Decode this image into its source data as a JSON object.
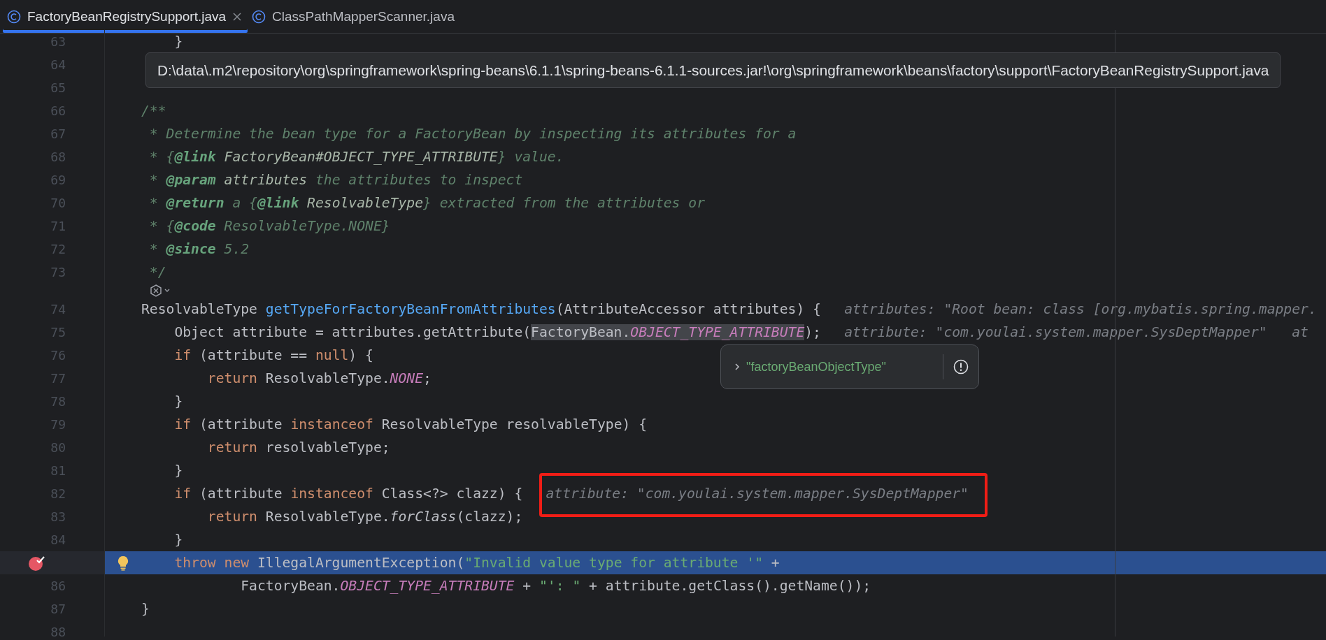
{
  "tabs": [
    {
      "label": "FactoryBeanRegistrySupport.java",
      "selected": true,
      "closable": true
    },
    {
      "label": "ClassPathMapperScanner.java",
      "selected": false,
      "closable": false
    }
  ],
  "path_tooltip": "D:\\data\\.m2\\repository\\org\\springframework\\spring-beans\\6.1.1\\spring-beans-6.1.1-sources.jar!\\org\\springframework\\beans\\factory\\support\\FactoryBeanRegistrySupport.java",
  "lines": [
    {
      "kind": "code",
      "n": "63",
      "current": false,
      "code": [
        {
          "kind": "plain",
          "text": "    }"
        }
      ]
    },
    {
      "kind": "code",
      "n": "64",
      "current": false
    },
    {
      "kind": "code",
      "n": "65",
      "current": false
    },
    {
      "kind": "code",
      "n": "66",
      "current": false,
      "code": [
        {
          "kind": "comment",
          "text": "/**"
        }
      ]
    },
    {
      "kind": "code",
      "n": "67",
      "current": false,
      "code": [
        {
          "kind": "comment",
          "text": " * Determine the bean type for a FactoryBean by inspecting its attributes for a"
        }
      ]
    },
    {
      "kind": "code",
      "n": "68",
      "current": false,
      "code": [
        {
          "kind": "comment",
          "text": " * {"
        },
        {
          "kind": "doctag",
          "text": "@link"
        },
        {
          "kind": "docref",
          "text": " FactoryBean#OBJECT_TYPE_ATTRIBUTE"
        },
        {
          "kind": "comment",
          "text": "} value."
        }
      ]
    },
    {
      "kind": "code",
      "n": "69",
      "current": false,
      "code": [
        {
          "kind": "comment",
          "text": " * "
        },
        {
          "kind": "doctag",
          "text": "@param"
        },
        {
          "kind": "docref",
          "text": " attributes"
        },
        {
          "kind": "comment",
          "text": " the attributes to inspect"
        }
      ]
    },
    {
      "kind": "code",
      "n": "70",
      "current": false,
      "code": [
        {
          "kind": "comment",
          "text": " * "
        },
        {
          "kind": "doctag",
          "text": "@return"
        },
        {
          "kind": "comment",
          "text": " a {"
        },
        {
          "kind": "doctag",
          "text": "@link"
        },
        {
          "kind": "docref",
          "text": " ResolvableType"
        },
        {
          "kind": "comment",
          "text": "} extracted from the attributes or"
        }
      ]
    },
    {
      "kind": "code",
      "n": "71",
      "current": false,
      "code": [
        {
          "kind": "comment",
          "text": " * {"
        },
        {
          "kind": "doctag",
          "text": "@code"
        },
        {
          "kind": "comment",
          "text": " ResolvableType.NONE}"
        }
      ]
    },
    {
      "kind": "code",
      "n": "72",
      "current": false,
      "code": [
        {
          "kind": "comment",
          "text": " * "
        },
        {
          "kind": "doctag",
          "text": "@since"
        },
        {
          "kind": "comment",
          "text": " 5.2"
        }
      ]
    },
    {
      "kind": "code",
      "n": "73",
      "current": false,
      "code": [
        {
          "kind": "comment",
          "text": " */"
        }
      ]
    },
    {
      "kind": "inlay",
      "current": false
    },
    {
      "kind": "code",
      "n": "74",
      "current": false,
      "code": [
        {
          "kind": "plain",
          "text": "ResolvableType "
        },
        {
          "kind": "decl",
          "text": "getTypeForFactoryBeanFromAttributes"
        },
        {
          "kind": "plain",
          "text": "(AttributeAccessor attributes) {"
        }
      ],
      "hints": [
        "attributes: \"Root bean: class [org.mybatis.spring.mapper."
      ]
    },
    {
      "kind": "code",
      "n": "75",
      "current": false,
      "code": [
        {
          "kind": "plain",
          "text": "    Object attribute = attributes.getAttribute("
        },
        {
          "kind": "marked",
          "text": "FactoryBean."
        },
        {
          "kind": "marked-static",
          "text": "OBJECT_TYPE_ATTRIBUTE"
        },
        {
          "kind": "plain",
          "text": ");"
        }
      ],
      "hints": [
        "attribute: \"com.youlai.system.mapper.SysDeptMapper\"",
        "at"
      ]
    },
    {
      "kind": "code",
      "n": "76",
      "current": false,
      "code": [
        {
          "kind": "keyword",
          "text": "    if"
        },
        {
          "kind": "plain",
          "text": " (attribute == "
        },
        {
          "kind": "keyword",
          "text": "null"
        },
        {
          "kind": "plain",
          "text": ") {"
        }
      ]
    },
    {
      "kind": "code",
      "n": "77",
      "current": false,
      "code": [
        {
          "kind": "keyword",
          "text": "        return"
        },
        {
          "kind": "plain",
          "text": " ResolvableType."
        },
        {
          "kind": "static",
          "text": "NONE"
        },
        {
          "kind": "plain",
          "text": ";"
        }
      ]
    },
    {
      "kind": "code",
      "n": "78",
      "current": false,
      "code": [
        {
          "kind": "plain",
          "text": "    }"
        }
      ]
    },
    {
      "kind": "code",
      "n": "79",
      "current": false,
      "code": [
        {
          "kind": "keyword",
          "text": "    if"
        },
        {
          "kind": "plain",
          "text": " (attribute "
        },
        {
          "kind": "keyword",
          "text": "instanceof"
        },
        {
          "kind": "plain",
          "text": " ResolvableType resolvableType) {"
        }
      ]
    },
    {
      "kind": "code",
      "n": "80",
      "current": false,
      "code": [
        {
          "kind": "keyword",
          "text": "        return"
        },
        {
          "kind": "plain",
          "text": " resolvableType;"
        }
      ]
    },
    {
      "kind": "code",
      "n": "81",
      "current": false,
      "code": [
        {
          "kind": "plain",
          "text": "    }"
        }
      ]
    },
    {
      "kind": "code",
      "n": "82",
      "current": false,
      "code": [
        {
          "kind": "keyword",
          "text": "    if"
        },
        {
          "kind": "plain",
          "text": " (attribute "
        },
        {
          "kind": "keyword",
          "text": "instanceof"
        },
        {
          "kind": "plain",
          "text": " Class<?> clazz) {"
        }
      ],
      "hints": [
        "attribute: \"com.youlai.system.mapper.SysDeptMapper\""
      ]
    },
    {
      "kind": "code",
      "n": "83",
      "current": false,
      "code": [
        {
          "kind": "keyword",
          "text": "        return"
        },
        {
          "kind": "plain",
          "text": " ResolvableType."
        },
        {
          "kind": "italic",
          "text": "forClass"
        },
        {
          "kind": "plain",
          "text": "(clazz);"
        }
      ]
    },
    {
      "kind": "code",
      "n": "84",
      "current": false,
      "code": [
        {
          "kind": "plain",
          "text": "    }"
        }
      ]
    },
    {
      "kind": "breakpoint",
      "current": true,
      "code": [
        {
          "kind": "keyword",
          "text": "    throw new"
        },
        {
          "kind": "plain",
          "text": " IllegalArgumentException("
        },
        {
          "kind": "string",
          "text": "\"Invalid value type for attribute '\""
        },
        {
          "kind": "plain",
          "text": " +"
        }
      ]
    },
    {
      "kind": "code",
      "n": "86",
      "current": false,
      "code": [
        {
          "kind": "plain",
          "text": "            FactoryBean."
        },
        {
          "kind": "static",
          "text": "OBJECT_TYPE_ATTRIBUTE"
        },
        {
          "kind": "plain",
          "text": " + "
        },
        {
          "kind": "string",
          "text": "\"': \""
        },
        {
          "kind": "plain",
          "text": " + attribute.getClass().getName());"
        }
      ]
    },
    {
      "kind": "code",
      "n": "87",
      "current": false,
      "code": [
        {
          "kind": "plain",
          "text": "}"
        }
      ]
    },
    {
      "kind": "code",
      "n": "88",
      "current": false
    }
  ],
  "value_popup": {
    "value": "\"factoryBeanObjectType\""
  },
  "annotation": {
    "kind": "red-rectangle"
  }
}
